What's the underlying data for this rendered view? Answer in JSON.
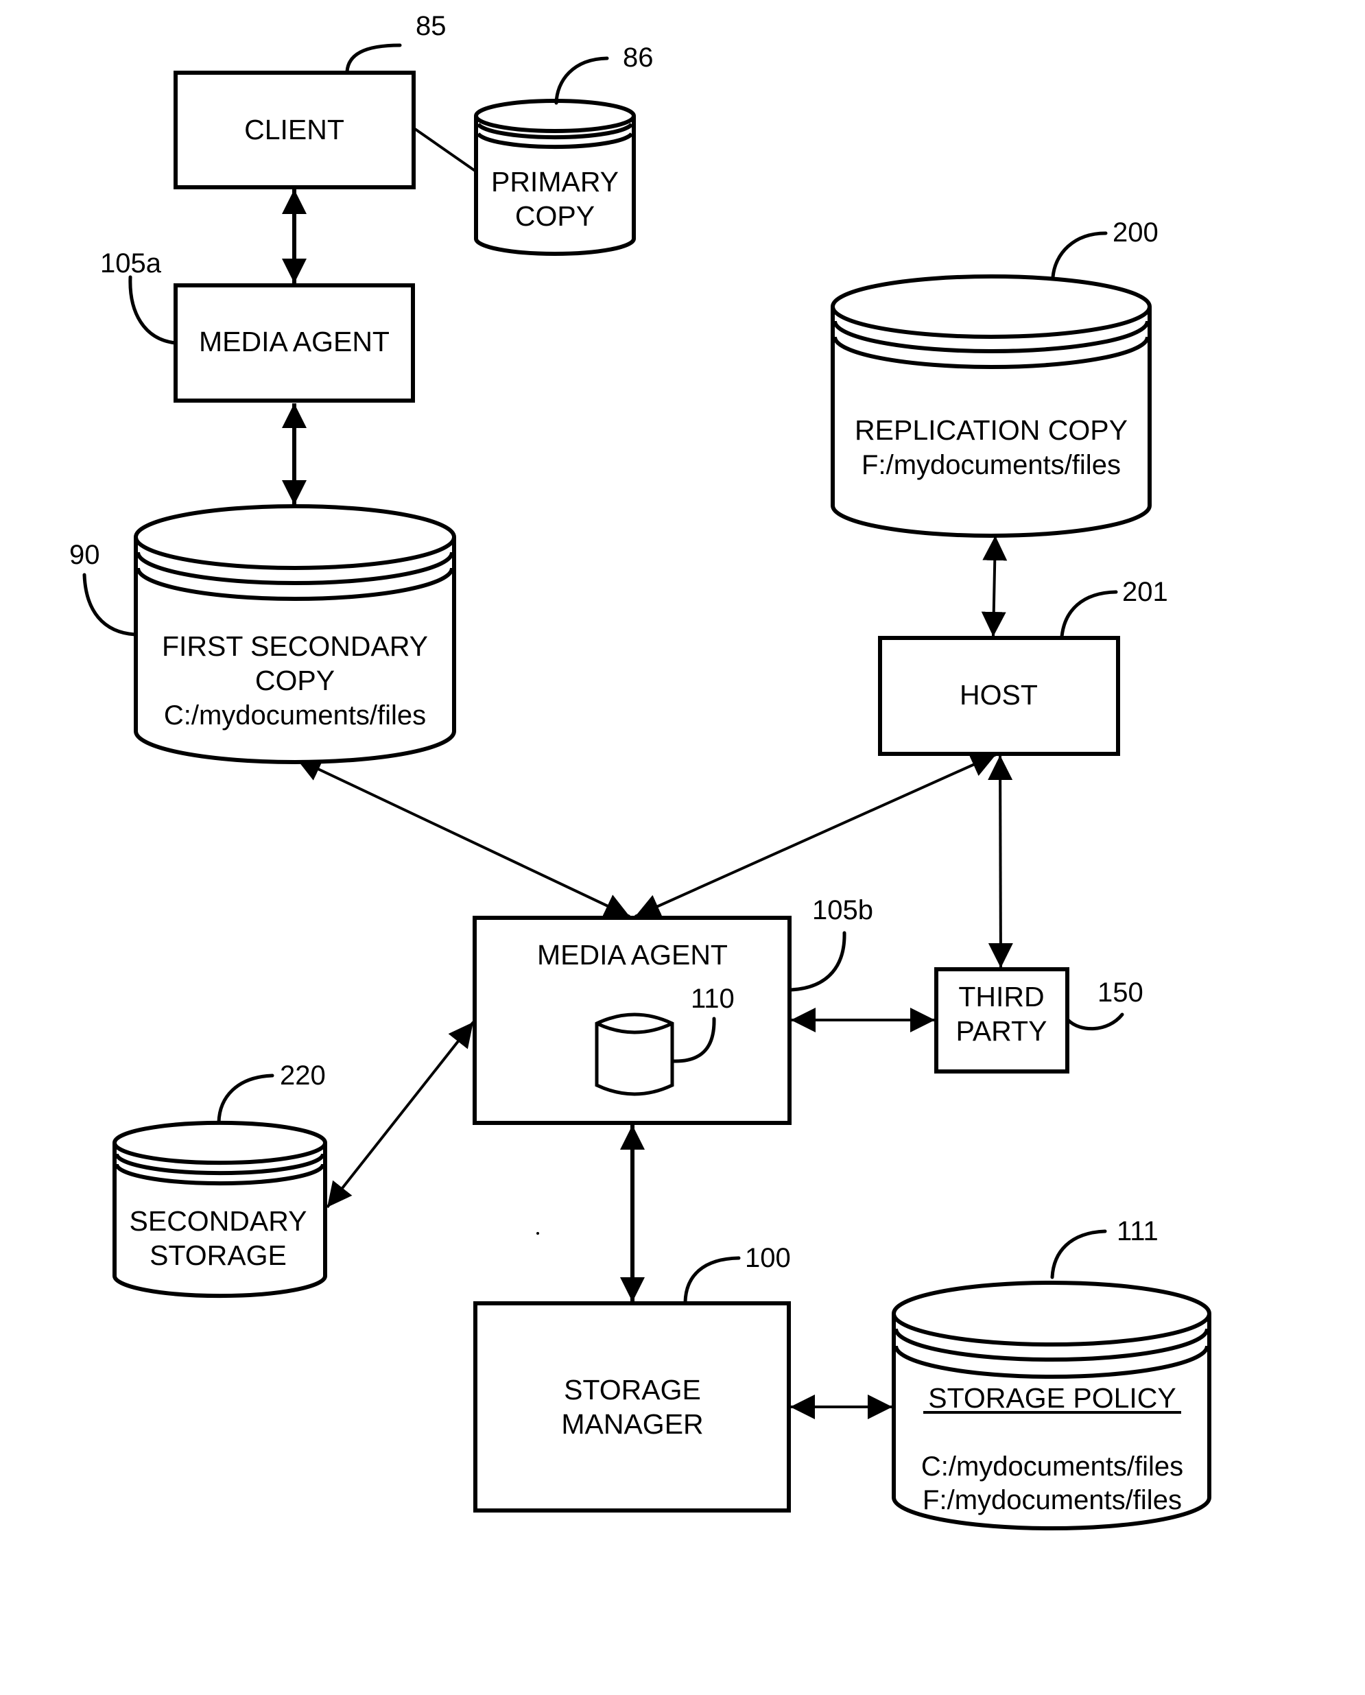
{
  "figure": {
    "type": "block-diagram",
    "background": "#ffffff",
    "ink": "#000000"
  },
  "nodes": {
    "client": {
      "shape": "box",
      "lines": [
        "CLIENT"
      ],
      "ref": "85"
    },
    "primary_copy": {
      "shape": "cylinder",
      "lines": [
        "PRIMARY",
        "COPY"
      ],
      "ref": "86"
    },
    "media_agent_a": {
      "shape": "box",
      "lines": [
        "MEDIA AGENT"
      ],
      "ref": "105a"
    },
    "first_secondary_copy": {
      "shape": "cylinder",
      "lines": [
        "FIRST SECONDARY",
        "COPY",
        "C:/mydocuments/files"
      ],
      "ref": "90"
    },
    "replication_copy": {
      "shape": "cylinder",
      "lines": [
        "REPLICATION COPY",
        "F:/mydocuments/files"
      ],
      "ref": "200"
    },
    "host": {
      "shape": "box",
      "lines": [
        "HOST"
      ],
      "ref": "201"
    },
    "media_agent_b": {
      "shape": "box",
      "lines": [
        "MEDIA AGENT"
      ],
      "ref": "105b",
      "index_ref": "110"
    },
    "third_party": {
      "shape": "box",
      "lines": [
        "THIRD",
        "PARTY"
      ],
      "ref": "150"
    },
    "secondary_storage": {
      "shape": "cylinder",
      "lines": [
        "SECONDARY",
        "STORAGE"
      ],
      "ref": "220"
    },
    "storage_manager": {
      "shape": "box",
      "lines": [
        "STORAGE",
        "MANAGER"
      ],
      "ref": "100"
    },
    "storage_policy": {
      "shape": "cylinder",
      "title": "STORAGE POLICY",
      "lines": [
        "C:/mydocuments/files",
        "F:/mydocuments/files"
      ],
      "ref": "111"
    }
  },
  "connections": [
    {
      "from": "client",
      "to": "primary_copy",
      "type": "line"
    },
    {
      "from": "client",
      "to": "media_agent_a",
      "type": "bidirectional-arrow"
    },
    {
      "from": "media_agent_a",
      "to": "first_secondary_copy",
      "type": "bidirectional-arrow"
    },
    {
      "from": "first_secondary_copy",
      "to": "media_agent_b",
      "type": "bidirectional-arrow"
    },
    {
      "from": "host",
      "to": "media_agent_b",
      "type": "bidirectional-arrow"
    },
    {
      "from": "replication_copy",
      "to": "host",
      "type": "bidirectional-arrow"
    },
    {
      "from": "host",
      "to": "third_party",
      "type": "bidirectional-arrow"
    },
    {
      "from": "media_agent_b",
      "to": "third_party",
      "type": "bidirectional-arrow"
    },
    {
      "from": "media_agent_b",
      "to": "secondary_storage",
      "type": "bidirectional-arrow"
    },
    {
      "from": "media_agent_b",
      "to": "storage_manager",
      "type": "bidirectional-arrow"
    },
    {
      "from": "storage_manager",
      "to": "storage_policy",
      "type": "bidirectional-arrow"
    }
  ]
}
